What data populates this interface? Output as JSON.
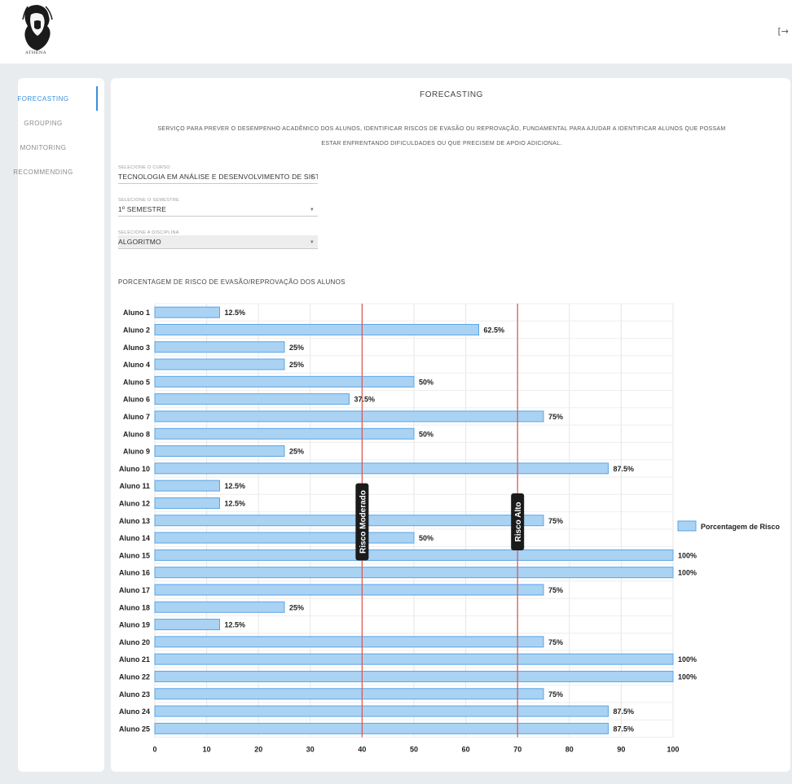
{
  "header": {
    "logo_text": "ATHENA",
    "logout_icon": "logout-icon",
    "logout_glyph": "[→"
  },
  "sidebar": {
    "items": [
      {
        "label": "FORECASTING",
        "active": true
      },
      {
        "label": "GROUPING",
        "active": false
      },
      {
        "label": "MONITORING",
        "active": false
      },
      {
        "label": "RECOMMENDING",
        "active": false
      }
    ]
  },
  "main": {
    "title": "FORECASTING",
    "description_line1": "Serviço para prever o desempenho acadêmico dos alunos, identificar riscos de evasão ou reprovação, fundamental para ajudar a identificar alunos que possam",
    "description_line2": "estar enfrentando dificuldades ou que precisem de apoio adicional.",
    "course": {
      "label": "Selecione o curso",
      "value": "Tecnologia em Análise e Desenvolvimento de Sistem..."
    },
    "semester": {
      "label": "Selecione o semestre",
      "value": "1º Semestre"
    },
    "discipline": {
      "label": "Selecione a disciplina",
      "value": "Algoritmo"
    },
    "chart_heading": "Porcentagem de Risco de Evasão/Reprovação dos Alunos"
  },
  "colors": {
    "accent": "#3b8ed8",
    "bar_fill": "#a9d2f3",
    "bar_stroke": "#5aa5e6",
    "threshold_line": "#d9534f"
  },
  "chart_data": {
    "type": "bar",
    "orientation": "horizontal",
    "categories": [
      "Aluno 1",
      "Aluno 2",
      "Aluno 3",
      "Aluno 4",
      "Aluno 5",
      "Aluno 6",
      "Aluno 7",
      "Aluno 8",
      "Aluno 9",
      "Aluno 10",
      "Aluno 11",
      "Aluno 12",
      "Aluno 13",
      "Aluno 14",
      "Aluno 15",
      "Aluno 16",
      "Aluno 17",
      "Aluno 18",
      "Aluno 19",
      "Aluno 20",
      "Aluno 21",
      "Aluno 22",
      "Aluno 23",
      "Aluno 24",
      "Aluno 25"
    ],
    "series": [
      {
        "name": "Porcentagem de Risco",
        "values": [
          12.5,
          62.5,
          25,
          25,
          50,
          37.5,
          75,
          50,
          25,
          87.5,
          12.5,
          12.5,
          75,
          50,
          100,
          100,
          75,
          25,
          12.5,
          75,
          100,
          100,
          75,
          87.5,
          87.5
        ]
      }
    ],
    "data_labels": [
      "12.5%",
      "62.5%",
      "25%",
      "25%",
      "50%",
      "37.5%",
      "75%",
      "50%",
      "25%",
      "87.5%",
      "12.5%",
      "12.5%",
      "75%",
      "50%",
      "100%",
      "100%",
      "75%",
      "25%",
      "12.5%",
      "75%",
      "100%",
      "100%",
      "75%",
      "87.5%",
      "87.5%"
    ],
    "xlim": [
      0,
      100
    ],
    "xticks": [
      0,
      10,
      20,
      30,
      40,
      50,
      60,
      70,
      80,
      90,
      100
    ],
    "grid": true,
    "legend": {
      "position": "right",
      "entries": [
        "Porcentagem de Risco"
      ]
    },
    "annotations": [
      {
        "type": "vline",
        "x": 40,
        "label": "Risco Moderado"
      },
      {
        "type": "vline",
        "x": 70,
        "label": "Risco Alto"
      }
    ]
  }
}
